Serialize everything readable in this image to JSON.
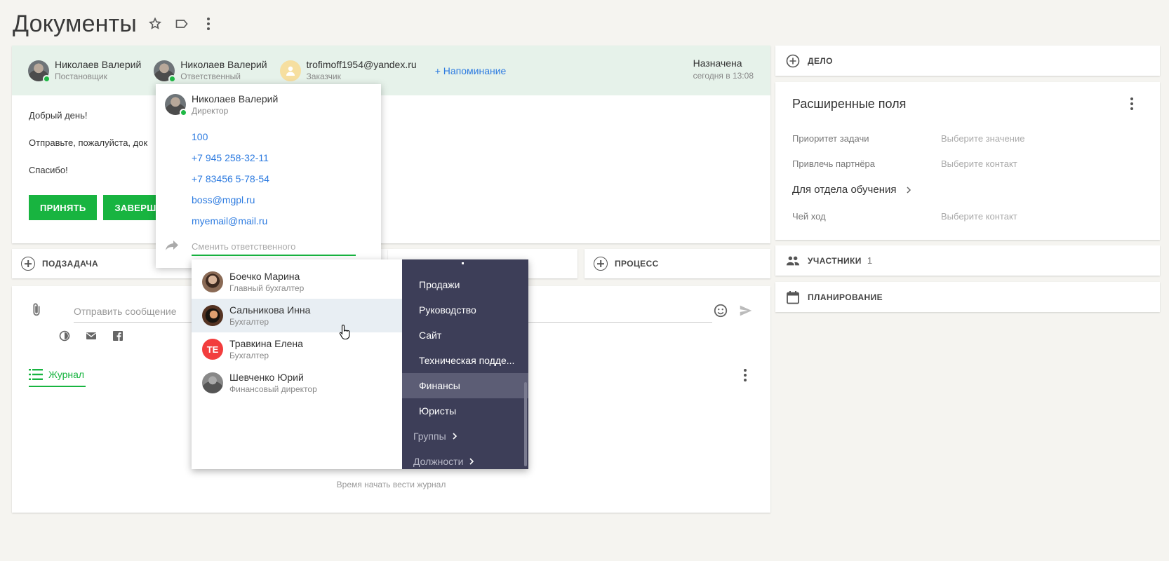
{
  "page": {
    "title": "Документы"
  },
  "task": {
    "participants": [
      {
        "name": "Николаев Валерий",
        "role": "Постановщик",
        "online": true
      },
      {
        "name": "Николаев Валерий",
        "role": "Ответственный",
        "online": true
      },
      {
        "name": "trofimoff1954@yandex.ru",
        "role": "Заказчик",
        "online": false
      }
    ],
    "reminder_label": "+ Напоминание",
    "assigned_label": "Назначена",
    "assigned_time": "сегодня в 13:08",
    "body": [
      "Добрый день!",
      "Отправьте, пожалуйста, док",
      "Спасибо!"
    ],
    "accept_label": "ПРИНЯТЬ",
    "finish_label": "ЗАВЕРШИТ"
  },
  "subtask_row": {
    "subtask_label": "ПОДЗАДАЧА",
    "process_label": "ПРОЦЕСС"
  },
  "message": {
    "placeholder": "Отправить сообщение",
    "journal_tab": "Журнал",
    "empty_text": "Время начать вести журнал"
  },
  "right_panel": {
    "case_label": "ДЕЛО",
    "ext_title": "Расширенные поля",
    "fields": [
      {
        "label": "Приоритет задачи",
        "value": "Выберите значение"
      },
      {
        "label": "Привлечь партнёра",
        "value": "Выберите контакт"
      }
    ],
    "group_label": "Для отдела обучения",
    "field_turn": {
      "label": "Чей ход",
      "value": "Выберите контакт"
    },
    "members_label": "УЧАСТНИКИ",
    "members_count": "1",
    "planning_label": "ПЛАНИРОВАНИЕ"
  },
  "contact_popup": {
    "name": "Николаев Валерий",
    "role": "Директор",
    "links": [
      "100",
      "+7 945 258-32-11",
      "+7 83456 5-78-54",
      "boss@mgpl.ru",
      "myemail@mail.ru"
    ],
    "change_placeholder": "Сменить ответственного"
  },
  "dropdown": {
    "people": [
      {
        "name": "Боечко Марина",
        "role": "Главный бухгалтер"
      },
      {
        "name": "Сальникова Инна",
        "role": "Бухгалтер"
      },
      {
        "name": "Травкина Елена",
        "role": "Бухгалтер",
        "initials": "TE"
      },
      {
        "name": "Шевченко Юрий",
        "role": "Финансовый директор"
      }
    ],
    "departments": [
      "Продажи",
      "Руководство",
      "Сайт",
      "Техническая подде...",
      "Финансы",
      "Юристы"
    ],
    "active_department": "Финансы",
    "groups_label": "Группы",
    "positions_label": "Должности"
  },
  "colors": {
    "accent": "#18b440",
    "link": "#2d7be0",
    "header_bg": "#e6f2ea",
    "sidebar_bg": "#3d3e58"
  }
}
